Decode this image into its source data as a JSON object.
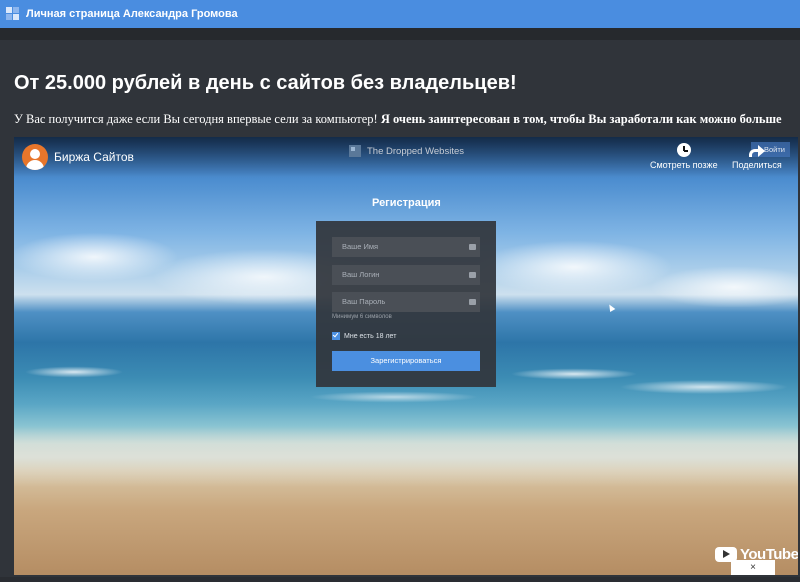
{
  "topbar": {
    "title": "Личная страница Александра Громова"
  },
  "article": {
    "headline": "От 25.000 рублей в день с сайтов без владельцев!",
    "subline_normal": "У Вас получится даже если Вы сегодня впервые сели за компьютер! ",
    "subline_bold": "Я очень заинтересован в том, чтобы Вы заработали как можно больше"
  },
  "video": {
    "channel_name": "Биржа Сайтов",
    "title": "The Dropped Websites",
    "watch_later_label": "Смотреть позже",
    "share_label": "Поделиться",
    "login_label": "Войти",
    "youtube_label": "YouTube",
    "close_label": "×"
  },
  "registration": {
    "title": "Регистрация",
    "name_placeholder": "Ваше Имя",
    "login_placeholder": "Ваш Логин",
    "password_placeholder": "Ваш Пароль",
    "password_hint": "Минимум 6 символов",
    "age_checkbox_label": "Мне есть 18 лет",
    "age_checked": true,
    "submit_label": "Зарегистрироваться"
  },
  "colors": {
    "topbar": "#4a8de0",
    "page_bg": "#30343a",
    "accent_button": "#4b8fe0",
    "channel_avatar": "#e8762b"
  }
}
